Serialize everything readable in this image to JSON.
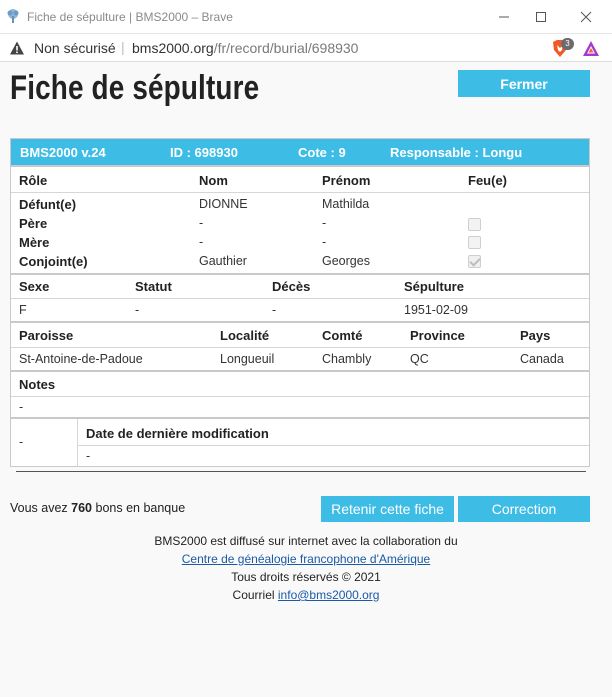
{
  "window": {
    "title": "Fiche de sépulture | BMS2000 – Brave"
  },
  "addressbar": {
    "security_label": "Non sécurisé",
    "separator": "|",
    "url_host": "bms2000.org",
    "url_path": "/fr/record/burial/698930",
    "shields_count": "3"
  },
  "page": {
    "title": "Fiche de sépulture",
    "close_label": "Fermer"
  },
  "record": {
    "header": {
      "version": "BMS2000 v.24",
      "id": "ID : 698930",
      "cote": "Cote : 9",
      "responsible": "Responsable : Longu"
    },
    "persons": {
      "columns": [
        "Rôle",
        "Nom",
        "Prénom",
        "Feu(e)"
      ],
      "rows": [
        {
          "role": "Défunt(e)",
          "nom": "DIONNE",
          "prenom": "Mathilda",
          "feu": null
        },
        {
          "role": "Père",
          "nom": "-",
          "prenom": "-",
          "feu": false
        },
        {
          "role": "Mère",
          "nom": "-",
          "prenom": "-",
          "feu": false
        },
        {
          "role": "Conjoint(e)",
          "nom": "Gauthier",
          "prenom": "Georges",
          "feu": true
        }
      ]
    },
    "details": {
      "columns": [
        "Sexe",
        "Statut",
        "Décès",
        "Sépulture"
      ],
      "values": [
        "F",
        "-",
        "-",
        "1951-02-09"
      ]
    },
    "place": {
      "columns": [
        "Paroisse",
        "Localité",
        "Comté",
        "Province",
        "Pays"
      ],
      "values": [
        "St-Antoine-de-Padoue",
        "Longueuil",
        "Chambly",
        "QC",
        "Canada"
      ]
    },
    "notes": {
      "label": "Notes",
      "value": "-"
    },
    "modification": {
      "left_value": "-",
      "label": "Date de dernière modification",
      "value": "-"
    }
  },
  "balance": {
    "prefix": "Vous avez ",
    "amount": "760",
    "suffix": " bons en banque"
  },
  "actions": {
    "keep_label": "Retenir cette fiche",
    "correction_label": "Correction"
  },
  "footer": {
    "line1": "BMS2000 est diffusé sur internet avec la collaboration du",
    "partner_link": "Centre de généalogie francophone d'Amérique",
    "rights": "Tous droits réservés © 2021",
    "email_prefix": "Courriel ",
    "email": "info@bms2000.org"
  },
  "colors": {
    "accent": "#3dbce6",
    "link": "#1a5aa8"
  }
}
